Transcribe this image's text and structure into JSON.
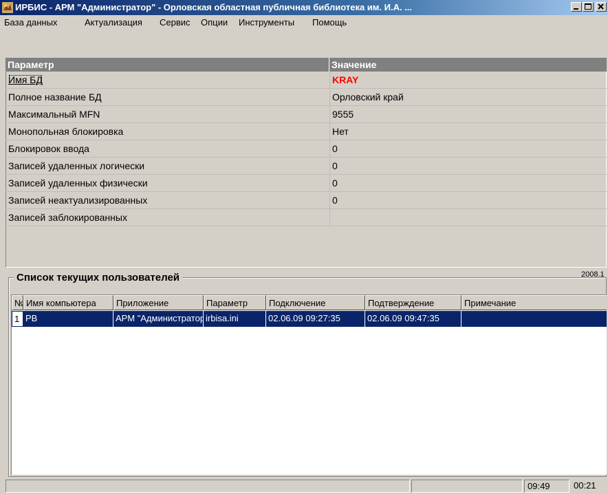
{
  "window": {
    "title": "ИРБИС - АРМ \"Администратор\" - Орловская областная публичная библиотека им. И.А. ..."
  },
  "menu": [
    "База данных",
    "Актуализация",
    "Сервис",
    "Опции",
    "Инструменты",
    "Помощь"
  ],
  "params": {
    "header": {
      "name": "Параметр",
      "value": "Значение"
    },
    "rows": [
      {
        "name": "Имя БД",
        "value": "KRAY"
      },
      {
        "name": "Полное название БД",
        "value": "Орловский край"
      },
      {
        "name": "Максимальный MFN",
        "value": "9555"
      },
      {
        "name": "Монопольная блокировка",
        "value": "Нет"
      },
      {
        "name": "Блокировок ввода",
        "value": "0"
      },
      {
        "name": "Записей удаленных логически",
        "value": "0"
      },
      {
        "name": "Записей удаленных физически",
        "value": "0"
      },
      {
        "name": "Записей неактуализированных",
        "value": "0"
      },
      {
        "name": "Записей заблокированных",
        "value": ""
      }
    ]
  },
  "users": {
    "caption": "Список текущих пользователей",
    "version": "2008.1",
    "columns": [
      "№",
      "Имя компьютера",
      "Приложение",
      "Параметр",
      "Подключение",
      "Подтверждение",
      "Примечание"
    ],
    "rows": [
      [
        "1",
        "PB",
        "АРМ \"Администратор\"",
        "irbisa.ini",
        "02.06.09 09:27:35",
        "02.06.09 09:47:35",
        ""
      ]
    ]
  },
  "status": {
    "time": "09:49",
    "elapsed": "00:21"
  },
  "colors": {
    "highlight": "#0a246a",
    "value_accent": "#ff0000",
    "title_start": "#0a246a"
  },
  "icons": {
    "app": "irbis-app-icon",
    "minimize": "minimize-icon",
    "maximize": "maximize-icon",
    "close": "close-icon"
  }
}
